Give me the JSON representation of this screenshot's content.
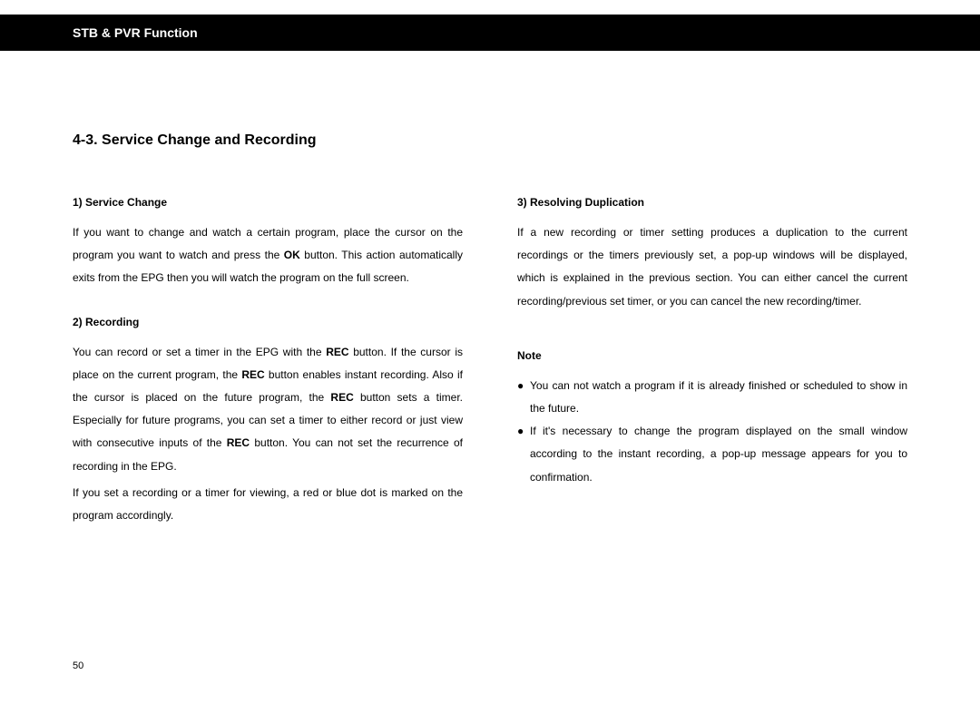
{
  "header": {
    "title": "STB & PVR Function"
  },
  "section": {
    "title": "4-3. Service Change and Recording"
  },
  "left": {
    "sub1": "1) Service Change",
    "p1a": "If you want to change and watch a certain program, place the cursor on the program you want to watch and press the ",
    "p1b_bold": "OK",
    "p1c": " button. This action automatically exits from the EPG then you will watch the program on the full screen.",
    "sub2": "2) Recording",
    "p2a": "You can record or set a timer in the EPG with the ",
    "p2b_bold": "REC",
    "p2c": " button. If the cursor is place on the current program, the ",
    "p2d_bold": "REC",
    "p2e": " button enables instant recording. Also if the cursor is placed on the future program, the ",
    "p2f_bold": "REC",
    "p2g": " button sets a timer. Especially for future programs, you can set a timer to either record or just view with consecutive inputs of the ",
    "p2h_bold": "REC",
    "p2i": " button. You can not set the recurrence of recording in the EPG.",
    "p3": "If you set a recording or a timer for viewing, a red or blue dot is marked on the program accordingly."
  },
  "right": {
    "sub3": "3) Resolving Duplication",
    "p4": "If a new recording or timer setting produces a duplication to the current recordings or the timers previously set, a pop-up windows will be displayed, which is explained in the previous section. You can either cancel the current recording/previous set timer, or you can cancel the new recording/timer.",
    "note_head": "Note",
    "bullet": "●",
    "n1": "You can not watch a program if it is already finished or scheduled to show in the future.",
    "n2": "If it's necessary to change the program displayed on the small window according to the instant recording, a pop-up message appears for you to confirmation."
  },
  "page_number": "50"
}
